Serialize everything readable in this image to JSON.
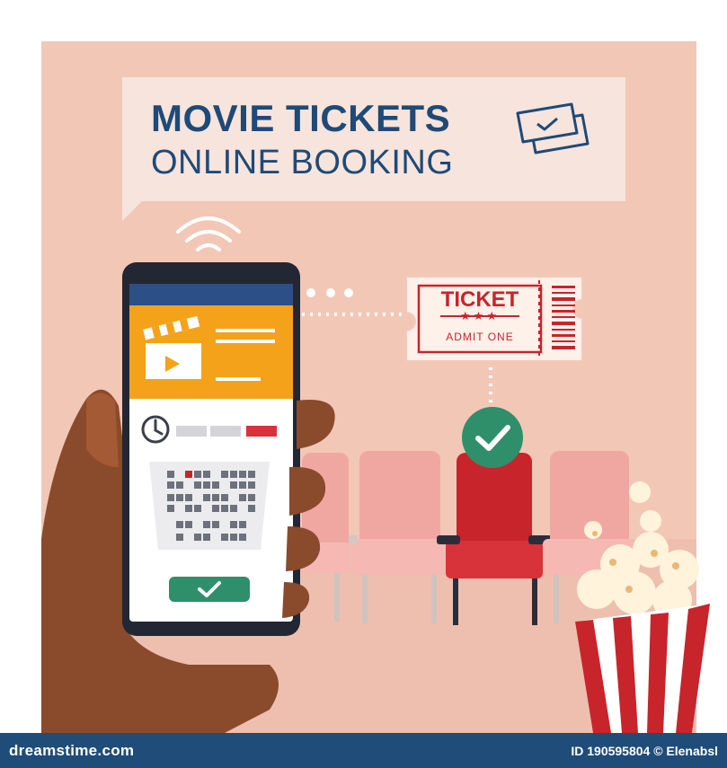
{
  "header": {
    "title_line1": "MOVIE TICKETS",
    "title_line2": "ONLINE BOOKING"
  },
  "ticket": {
    "label": "TICKET",
    "stars": "★★★",
    "subtitle": "ADMIT ONE"
  },
  "footer": {
    "brand": "dreamstime.com",
    "credit": "ID 190595804 © Elenabsl"
  },
  "colors": {
    "background": "#f2c7b6",
    "title": "#1e4a78",
    "phone_header": "#f4a21a",
    "confirm_green": "#2f8f6b",
    "seat_selected": "#c8242b",
    "seat_default": "#f1a7a1",
    "footer_bar": "#1f4c78"
  },
  "icons": [
    "tickets-icon",
    "wifi-icon",
    "clapperboard-icon",
    "clock-icon",
    "check-icon",
    "popcorn-icon",
    "barcode-icon"
  ]
}
